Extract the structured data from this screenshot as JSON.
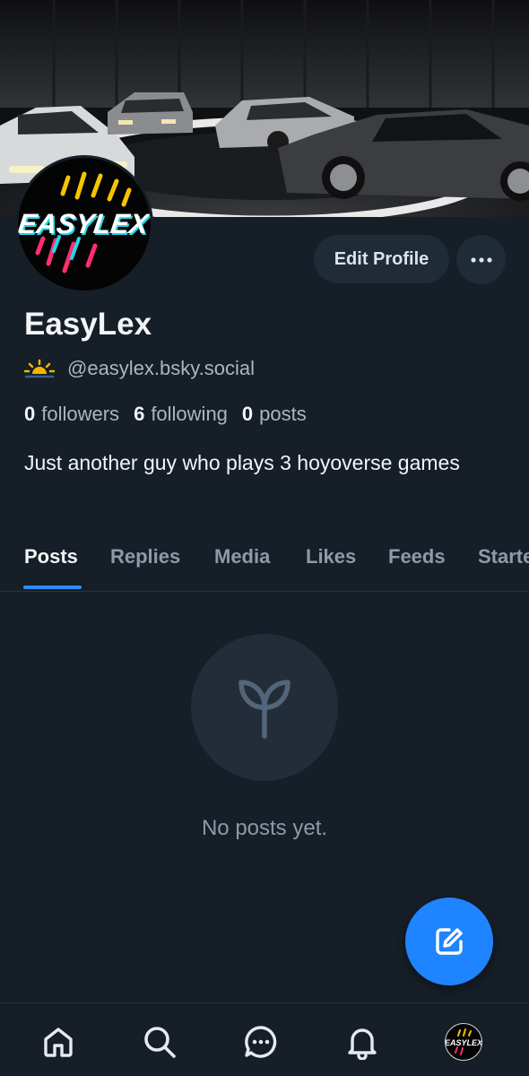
{
  "profile": {
    "display_name": "EasyLex",
    "handle": "@easylex.bsky.social",
    "followers_count": "0",
    "followers_label": "followers",
    "following_count": "6",
    "following_label": "following",
    "posts_count": "0",
    "posts_label": "posts",
    "bio": "Just another guy who plays 3 hoyoverse games",
    "avatar_text": "EASYLEX"
  },
  "actions": {
    "edit_profile_label": "Edit Profile"
  },
  "tabs": [
    {
      "label": "Posts",
      "active": true
    },
    {
      "label": "Replies",
      "active": false
    },
    {
      "label": "Media",
      "active": false
    },
    {
      "label": "Likes",
      "active": false
    },
    {
      "label": "Feeds",
      "active": false
    },
    {
      "label": "Starter Packs",
      "active": false
    }
  ],
  "empty_state": {
    "icon": "seedling-icon",
    "text": "No posts yet."
  },
  "bottom_nav": [
    "home-icon",
    "search-icon",
    "chat-icon",
    "bell-icon",
    "profile-avatar"
  ],
  "colors": {
    "background": "#161e27",
    "accent": "#1e84ff",
    "button_bg": "#1f2b37",
    "muted_text": "#8d9aa8"
  }
}
